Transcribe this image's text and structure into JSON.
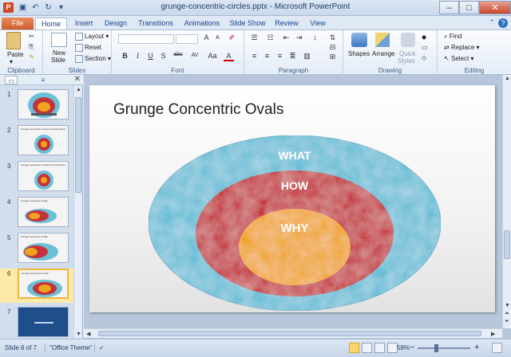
{
  "window": {
    "title": "grunge-concentric-circles.pptx - Microsoft PowerPoint",
    "app_icon_letter": "P",
    "minimize": "–",
    "maximize": "□",
    "close": "✕"
  },
  "tabs": [
    "File",
    "Home",
    "Insert",
    "Design",
    "Transitions",
    "Animations",
    "Slide Show",
    "Review",
    "View"
  ],
  "ribbon": {
    "clipboard": {
      "paste": "Paste",
      "label": "Clipboard"
    },
    "slides": {
      "new_slide": "New",
      "new_slide2": "Slide",
      "layout": "Layout",
      "reset": "Reset",
      "section": "Section",
      "label": "Slides"
    },
    "font": {
      "bold": "B",
      "italic": "I",
      "underline": "U",
      "shadow": "S",
      "strike": "abc",
      "spacing": "AV",
      "case": "Aa",
      "grow": "A",
      "shrink": "A",
      "label": "Font"
    },
    "paragraph": {
      "label": "Paragraph"
    },
    "drawing": {
      "shapes": "Shapes",
      "arrange": "Arrange",
      "quick_styles": "Quick",
      "quick_styles2": "Styles",
      "label": "Drawing"
    },
    "editing": {
      "find": "Find",
      "replace": "Replace",
      "select": "Select",
      "label": "Editing"
    }
  },
  "thumbnails": [
    {
      "num": "1",
      "title": ""
    },
    {
      "num": "2",
      "title": "Grunge Concentric Circles for PowerPoint"
    },
    {
      "num": "3",
      "title": "Grunge Concentric Circles for PowerPoint"
    },
    {
      "num": "4",
      "title": "Grunge Concentric Ovals"
    },
    {
      "num": "5",
      "title": "Grunge Concentric Ovals"
    },
    {
      "num": "6",
      "title": "Grunge Concentric Ovals"
    },
    {
      "num": "7",
      "title": ""
    }
  ],
  "slide": {
    "title": "Grunge Concentric Ovals",
    "outer_label": "WHAT",
    "middle_label": "HOW",
    "inner_label": "WHY",
    "colors": {
      "outer": "#6cbfd8",
      "middle": "#c4333a",
      "inner": "#f0a41c"
    }
  },
  "status": {
    "slide_info": "Slide 6 of 7",
    "theme": "\"Office Theme\"",
    "zoom": "58%",
    "zoom_minus": "−",
    "zoom_plus": "+"
  }
}
